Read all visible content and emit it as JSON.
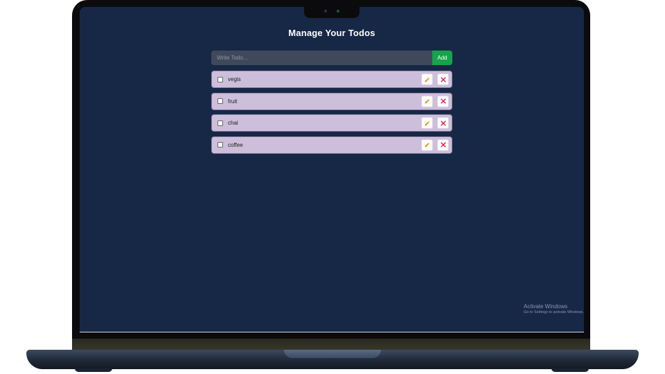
{
  "app": {
    "title": "Manage Your Todos"
  },
  "form": {
    "placeholder": "Write Todo...",
    "value": "",
    "add_label": "Add"
  },
  "todos": [
    {
      "text": "vegis",
      "completed": false
    },
    {
      "text": "fruit",
      "completed": false
    },
    {
      "text": "chai",
      "completed": false
    },
    {
      "text": "coffee",
      "completed": false
    }
  ],
  "icons": {
    "edit": "pencil-icon",
    "delete": "close-icon"
  },
  "watermark": {
    "line1": "Activate Windows",
    "line2": "Go to Settings to activate Windows."
  },
  "colors": {
    "background": "#172846",
    "row_background": "#cdbfdb",
    "add_button": "#16a34a",
    "input_background": "#40495b",
    "edit_icon": "#f59e0b",
    "delete_icon": "#e11d48"
  }
}
